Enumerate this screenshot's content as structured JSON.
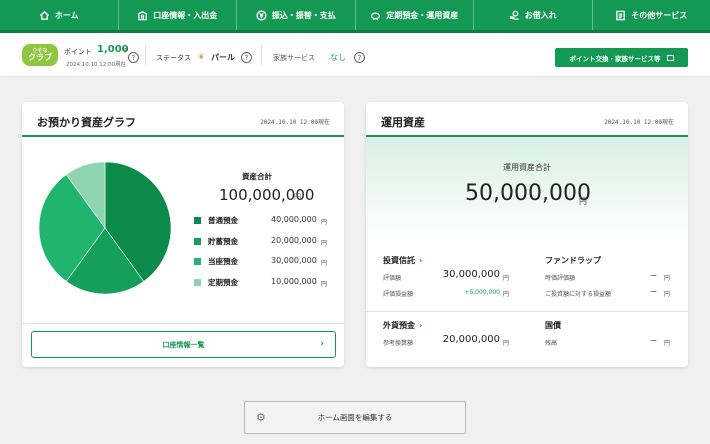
{
  "nav": {
    "items": [
      {
        "label": "ホーム",
        "icon": "home-icon"
      },
      {
        "label": "口座情報・入出金",
        "icon": "bank-icon"
      },
      {
        "label": "振込・振替・支払",
        "icon": "yen-coin-icon"
      },
      {
        "label": "定期預金・運用資産",
        "icon": "piggy-bank-icon"
      },
      {
        "label": "お借入れ",
        "icon": "money-hand-icon"
      },
      {
        "label": "その他サービス",
        "icon": "document-icon"
      }
    ]
  },
  "status": {
    "club_logo": "クラブ",
    "club_logo_small": "りそな",
    "point_label": "ポイント",
    "point_value": "1,000",
    "point_unit": "P",
    "point_date": "2024.10.10 12:00現在",
    "stage_label": "ステータス",
    "stage_value": "パール",
    "family_label": "家族サービス",
    "family_value": "なし",
    "point_button": "ポイント交換・家族サービス等"
  },
  "asset_graph": {
    "title": "お預かり資産グラフ",
    "date": "2024.10.10 12:00現在",
    "total_label": "資産合計",
    "total_value": "100,000,000",
    "unit": "円",
    "legend": [
      {
        "name": "普通預金",
        "value": "40,000,000",
        "color": "#0b8a4a"
      },
      {
        "name": "貯蓄預金",
        "value": "20,000,000",
        "color": "#14a05a"
      },
      {
        "name": "当座預金",
        "value": "30,000,000",
        "color": "#20b46e"
      },
      {
        "name": "定期預金",
        "value": "10,000,000",
        "color": "#8fd4b0"
      }
    ],
    "account_button": "口座情報一覧"
  },
  "chart_data": {
    "type": "pie",
    "categories": [
      "普通預金",
      "貯蓄預金",
      "当座預金",
      "定期預金"
    ],
    "values": [
      40000000,
      20000000,
      30000000,
      10000000
    ],
    "colors": [
      "#0b8a4a",
      "#14a05a",
      "#20b46e",
      "#8fd4b0"
    ],
    "title": "",
    "legend": "right"
  },
  "investment": {
    "title": "運用資産",
    "date": "2024.10.10 12:00現在",
    "total_label": "運用資産合計",
    "total_value": "50,000,000",
    "unit": "円",
    "trust_title": "投資信託",
    "trust_eval_label": "評価額",
    "trust_eval_value": "30,000,000",
    "trust_gain_label": "評価損益額",
    "trust_gain_value": "+5,000,000",
    "fund_title": "ファンドラップ",
    "fund_eval_label": "時価評価額",
    "fund_eval_value": "ー",
    "fund_gain_label": "ご投資額に対する損益額",
    "fund_gain_value": "ー",
    "fx_title": "外貨預金",
    "fx_label": "参考換算額",
    "fx_value": "20,000,000",
    "jgb_title": "国債",
    "jgb_label": "残高",
    "jgb_value": "ー"
  },
  "edit_button": "ホーム画面を編集する"
}
